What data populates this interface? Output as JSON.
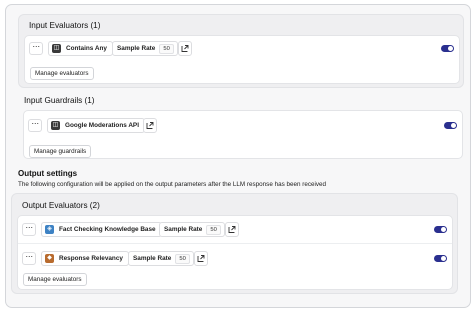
{
  "input_evaluators": {
    "title": "Input Evaluators (1)",
    "items": [
      {
        "name": "Contains Any",
        "icon": "evaluator-icon",
        "sample_rate_label": "Sample Rate",
        "sample_rate_value": "50",
        "enabled": true
      }
    ],
    "manage_label": "Manage evaluators"
  },
  "input_guardrails": {
    "title": "Input Guardrails (1)",
    "items": [
      {
        "name": "Google Moderations API",
        "icon": "guardrail-icon",
        "enabled": true
      }
    ],
    "manage_label": "Manage guardrails"
  },
  "output_settings": {
    "heading": "Output settings",
    "description": "The following configuration will be applied on the output parameters after the LLM response has been received"
  },
  "output_evaluators": {
    "title": "Output Evaluators (2)",
    "items": [
      {
        "name": "Fact Checking Knowledge Base",
        "icon": "knowledge-base-icon",
        "sample_rate_label": "Sample Rate",
        "sample_rate_value": "50",
        "enabled": true
      },
      {
        "name": "Response Relevancy",
        "icon": "relevancy-icon",
        "sample_rate_label": "Sample Rate",
        "sample_rate_value": "50",
        "enabled": true
      }
    ],
    "manage_label": "Manage evaluators"
  },
  "colors": {
    "toggle_on": "#2a2f8f",
    "kb_icon": "#3d82c4",
    "relevancy_icon": "#b86b2e",
    "dark_icon": "#3a3a3a"
  }
}
